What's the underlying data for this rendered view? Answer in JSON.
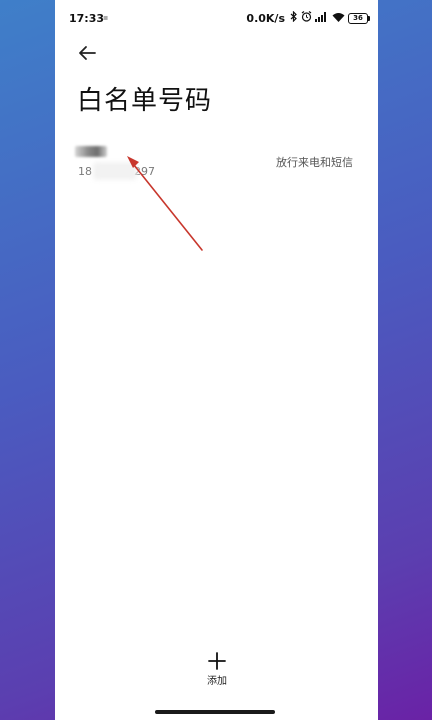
{
  "status_bar": {
    "time": "17:33",
    "speed": "0.0K/s",
    "battery": "36"
  },
  "header": {
    "title": "白名单号码"
  },
  "entry": {
    "number_prefix": "18",
    "number_suffix": "297",
    "action": "放行来电和短信"
  },
  "footer": {
    "add_label": "添加"
  },
  "colors": {
    "annotation_arrow": "#c8362c",
    "background_gradient_start": "#3f7fc9",
    "background_gradient_end": "#6a22a6"
  },
  "icons": {
    "back": "arrow-left-icon",
    "add": "plus-icon"
  }
}
